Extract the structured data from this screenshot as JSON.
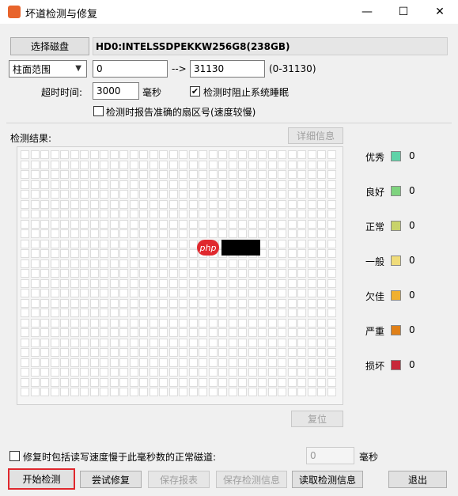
{
  "window": {
    "title": "坏道检测与修复",
    "minimize_glyph": "—",
    "maximize_glyph": "☐",
    "close_glyph": "✕"
  },
  "disk": {
    "select_button": "选择磁盘",
    "name": "HD0:INTELSSDPEKKW256G8(238GB)"
  },
  "range": {
    "mode": "柱面范围",
    "start": "0",
    "arrow": "-->",
    "end": "31130",
    "hint": "(0-31130)"
  },
  "timeout": {
    "label": "超时时间:",
    "value": "3000",
    "unit": "毫秒",
    "prevent_sleep_label": "检测时阻止系统睡眠",
    "prevent_sleep_checked": true,
    "report_sector_label": "检测时报告准确的扇区号(速度较慢)",
    "report_sector_checked": false
  },
  "results": {
    "label": "检测结果:",
    "details_button": "详细信息",
    "reset_button": "复位",
    "watermark": "php"
  },
  "legend": [
    {
      "label": "优秀",
      "count": "0",
      "color": "#5fd3a8"
    },
    {
      "label": "良好",
      "count": "0",
      "color": "#7ed37e"
    },
    {
      "label": "正常",
      "count": "0",
      "color": "#c8d36a"
    },
    {
      "label": "一般",
      "count": "0",
      "color": "#f0dc7a"
    },
    {
      "label": "欠佳",
      "count": "0",
      "color": "#f0b030"
    },
    {
      "label": "严重",
      "count": "0",
      "color": "#e08018"
    },
    {
      "label": "损坏",
      "count": "0",
      "color": "#c8283a"
    }
  ],
  "repair_option": {
    "label": "修复时包括读写速度慢于此毫秒数的正常磁道:",
    "checked": false,
    "value": "0",
    "unit": "毫秒"
  },
  "actions": {
    "start": "开始检测",
    "try_repair": "尝试修复",
    "save_report": "保存报表",
    "save_info": "保存检测信息",
    "load_info": "读取检测信息",
    "exit": "退出"
  }
}
